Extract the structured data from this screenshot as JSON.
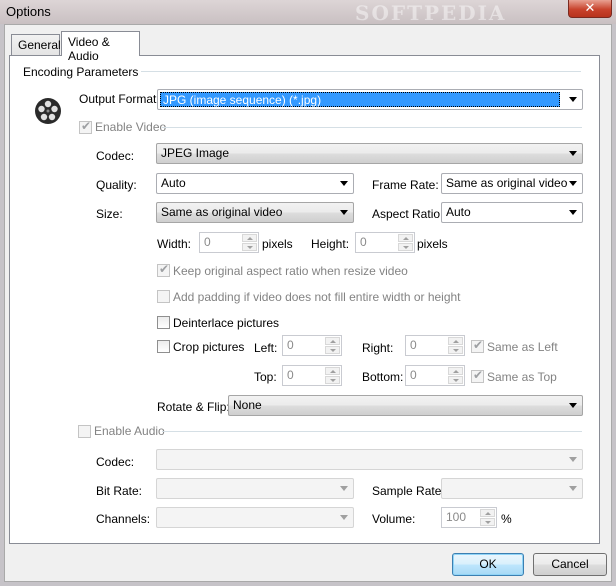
{
  "window": {
    "title": "Options",
    "watermark": "SOFTPEDIA",
    "close_glyph": "✕"
  },
  "tabs": [
    {
      "label": "General"
    },
    {
      "label": "Video & Audio"
    }
  ],
  "encoding": {
    "group_title": "Encoding Parameters",
    "output_format_label": "Output Format:",
    "output_format_value": "JPG (image sequence) (*.jpg)"
  },
  "video": {
    "enable_label": "Enable Video",
    "codec_label": "Codec:",
    "codec_value": "JPEG Image",
    "quality_label": "Quality:",
    "quality_value": "Auto",
    "frame_rate_label": "Frame Rate:",
    "frame_rate_value": "Same as original video",
    "size_label": "Size:",
    "size_value": "Same as original video",
    "aspect_label": "Aspect Ratio:",
    "aspect_value": "Auto",
    "width_label": "Width:",
    "width_value": "0",
    "width_unit": "pixels",
    "height_label": "Height:",
    "height_value": "0",
    "height_unit": "pixels",
    "keep_aspect_label": "Keep original aspect ratio when resize video",
    "add_padding_label": "Add padding if video does not fill entire width or height",
    "deinterlace_label": "Deinterlace pictures",
    "crop_label": "Crop pictures",
    "left_label": "Left:",
    "left_value": "0",
    "right_label": "Right:",
    "right_value": "0",
    "top_label": "Top:",
    "top_value": "0",
    "bottom_label": "Bottom:",
    "bottom_value": "0",
    "same_as_left_label": "Same as Left",
    "same_as_top_label": "Same as Top",
    "rotate_label": "Rotate & Flip:",
    "rotate_value": "None"
  },
  "audio": {
    "enable_label": "Enable Audio",
    "codec_label": "Codec:",
    "bitrate_label": "Bit Rate:",
    "samplerate_label": "Sample Rate:",
    "channels_label": "Channels:",
    "volume_label": "Volume:",
    "volume_value": "100",
    "volume_unit": "%"
  },
  "buttons": {
    "ok": "OK",
    "cancel": "Cancel"
  }
}
